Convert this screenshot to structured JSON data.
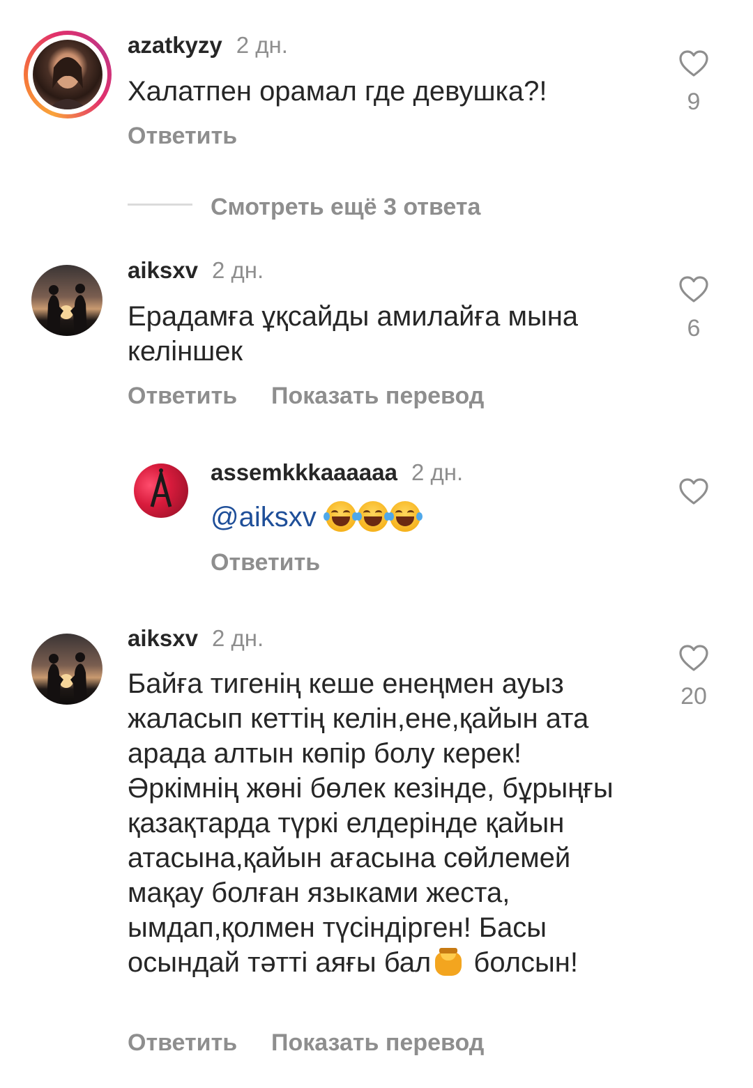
{
  "comments": [
    {
      "username": "azatkyzy",
      "time": "2 дн.",
      "text": "Халатпен орамал где девушка?!",
      "likes": "9",
      "reply_label": "Ответить"
    },
    {
      "username": "aiksxv",
      "time": "2 дн.",
      "text": "Ерадамға ұқсайды амилайға мына келіншек",
      "likes": "6",
      "reply_label": "Ответить",
      "translate_label": "Показать перевод"
    },
    {
      "username": "assemkkkaaaaaa",
      "time": "2 дн.",
      "mention": "@aiksxv",
      "emojis": [
        "face-with-tears-of-joy",
        "face-with-tears-of-joy",
        "face-with-tears-of-joy"
      ],
      "reply_label": "Ответить"
    },
    {
      "username": "aiksxv",
      "time": "2 дн.",
      "text_before_emoji": "Байға тигенің кеше енеңмен ауыз жаласып кеттің келін,ене,қайын ата арада алтын көпір болу керек! Әркімнің жөні бөлек кезінде, бұрыңғы қазақтарда түркі елдерінде қайын атасына,қайын ағасына сөйлемей мақау болған языками жеста, ымдап,қолмен түсіндірген! Басы осындай тәтті аяғы бал",
      "emoji": "honey-pot",
      "text_after_emoji": "болсын!",
      "likes": "20",
      "reply_label": "Ответить",
      "translate_label": "Показать перевод"
    }
  ],
  "view_more_replies": "Смотреть ещё 3 ответа",
  "colors": {
    "text": "#262626",
    "secondary": "#8e8e8e",
    "mention": "#1f4f99",
    "divider": "#dbdbdb"
  },
  "icons": {
    "like": "heart-outline-icon"
  }
}
